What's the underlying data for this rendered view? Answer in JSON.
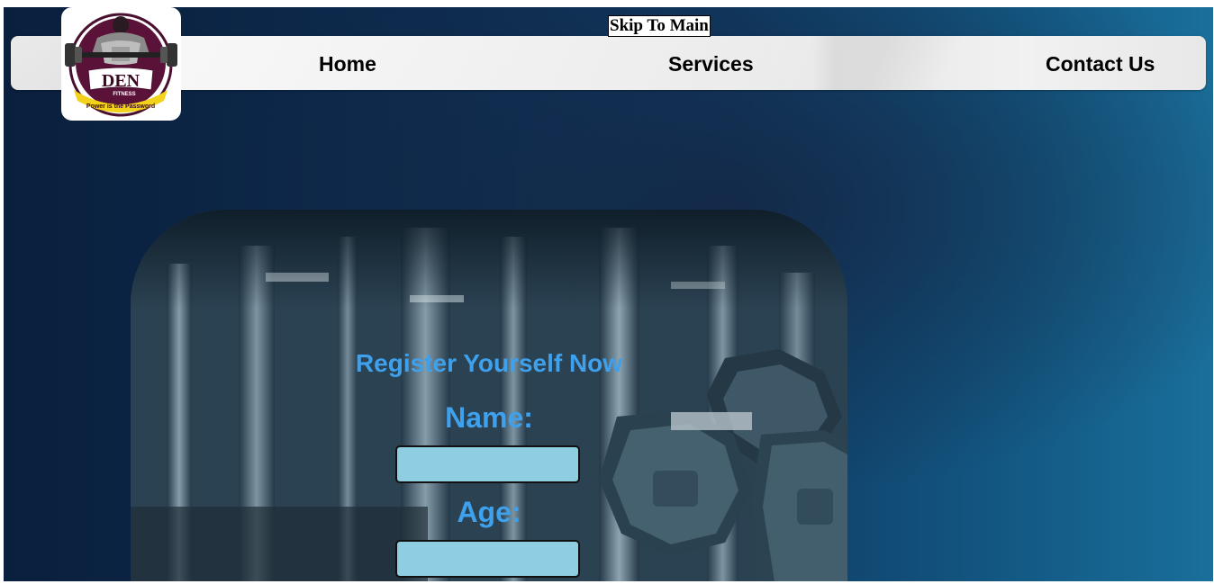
{
  "skip_link": {
    "label": "Skip To Main"
  },
  "logo": {
    "brand": "DEN",
    "sub": "FITNESS",
    "tagline": "Power is the Password"
  },
  "nav": {
    "items": [
      {
        "label": "Home"
      },
      {
        "label": "Services"
      },
      {
        "label": "Contact Us"
      }
    ]
  },
  "register_form": {
    "title": "Register Yourself Now",
    "fields": [
      {
        "label": "Name:",
        "value": "",
        "placeholder": ""
      },
      {
        "label": "Age:",
        "value": "",
        "placeholder": ""
      }
    ],
    "input_color": "#8ecde2",
    "label_color": "#3fa0ec"
  },
  "colors": {
    "background_dark": "#0a1f3d",
    "background_light": "#1a6f9b"
  }
}
